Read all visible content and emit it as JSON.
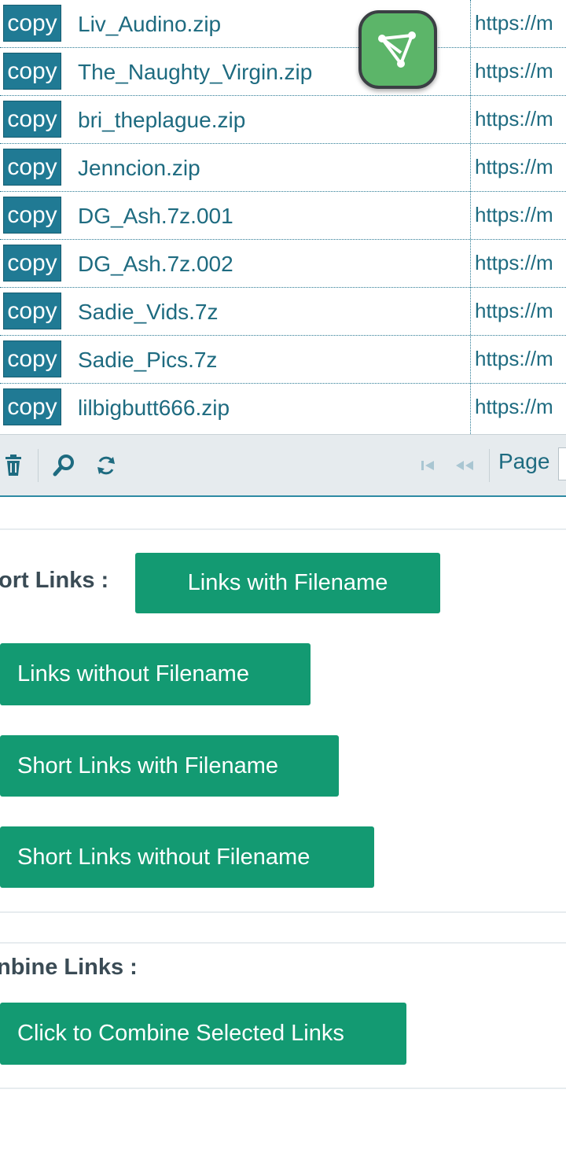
{
  "grid": {
    "copy_label": "copy",
    "url_prefix": "https://m",
    "rows": [
      {
        "file": "Liv_Audino.zip"
      },
      {
        "file": "The_Naughty_Virgin.zip"
      },
      {
        "file": "bri_theplague.zip"
      },
      {
        "file": "Jenncion.zip"
      },
      {
        "file": "DG_Ash.7z.001"
      },
      {
        "file": "DG_Ash.7z.002"
      },
      {
        "file": "Sadie_Vids.7z"
      },
      {
        "file": "Sadie_Pics.7z"
      },
      {
        "file": "lilbigbutt666.zip"
      }
    ]
  },
  "floating_button": {
    "icon": "share-triangle-icon",
    "color": "#5cb569"
  },
  "pager": {
    "page_label": "Page",
    "icons": [
      "trash-icon",
      "search-icon",
      "refresh-icon",
      "first-page-icon",
      "prev-page-icon"
    ]
  },
  "short_links": {
    "label": "ort Links :",
    "buttons": [
      "Links with Filename",
      "Links without Filename",
      "Short Links with Filename",
      "Short Links without Filename"
    ]
  },
  "combine": {
    "label": "nbine Links :",
    "button": "Click to Combine Selected Links"
  },
  "colors": {
    "accent": "#139a72",
    "copy_button": "#207a94",
    "link_text": "#1e6b80"
  }
}
